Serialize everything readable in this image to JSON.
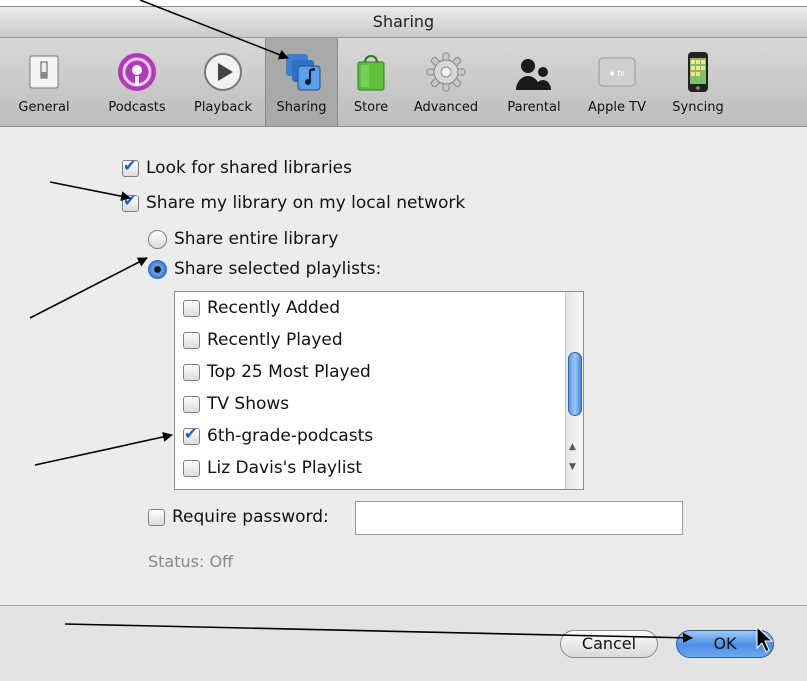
{
  "window": {
    "title": "Sharing"
  },
  "toolbar": {
    "items": [
      {
        "label": "General",
        "icon": "switch-icon"
      },
      {
        "label": "Podcasts",
        "icon": "podcast-icon"
      },
      {
        "label": "Playback",
        "icon": "play-icon"
      },
      {
        "label": "Sharing",
        "icon": "sharing-icon",
        "selected": true
      },
      {
        "label": "Store",
        "icon": "shopping-bag-icon"
      },
      {
        "label": "Advanced",
        "icon": "gear-icon"
      },
      {
        "label": "Parental",
        "icon": "parental-icon"
      },
      {
        "label": "Apple TV",
        "icon": "apple-tv-icon"
      },
      {
        "label": "Syncing",
        "icon": "iphone-icon"
      }
    ]
  },
  "options": {
    "look_for_shared": {
      "label": "Look for shared libraries",
      "checked": true
    },
    "share_library": {
      "label": "Share my library on my local network",
      "checked": true
    },
    "share_entire": {
      "label": "Share entire library",
      "selected": false
    },
    "share_selected": {
      "label": "Share selected playlists:",
      "selected": true
    }
  },
  "playlists": [
    {
      "label": "Recently Added",
      "checked": false
    },
    {
      "label": "Recently Played",
      "checked": false
    },
    {
      "label": "Top 25 Most Played",
      "checked": false
    },
    {
      "label": "TV Shows",
      "checked": false
    },
    {
      "label": "6th-grade-podcasts",
      "checked": true
    },
    {
      "label": "Liz Davis's Playlist",
      "checked": false
    }
  ],
  "password": {
    "label": "Require password:",
    "checked": false,
    "value": ""
  },
  "status": "Status: Off",
  "buttons": {
    "cancel": "Cancel",
    "ok": "OK"
  },
  "colors": {
    "accent": "#2a74d6",
    "annotation": "#000000"
  }
}
